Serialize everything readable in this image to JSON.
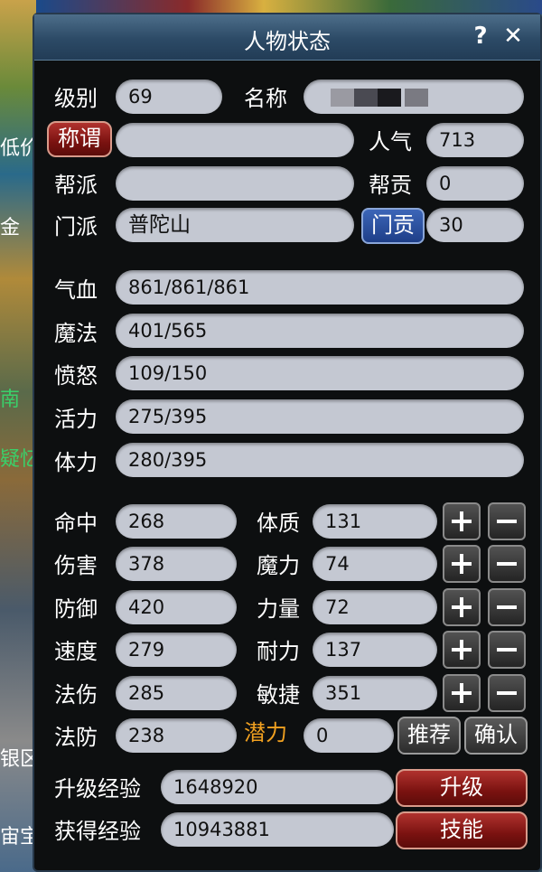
{
  "background": {
    "edge_texts": [
      "低价",
      "金",
      "南",
      "疑忆",
      "银区",
      "宙宝"
    ]
  },
  "window": {
    "title": "人物状态",
    "help": "?",
    "close": "✕"
  },
  "basic": {
    "level_label": "级别",
    "level": "69",
    "name_label": "名称",
    "name": "",
    "title_button": "称谓",
    "title_value": "",
    "popularity_label": "人气",
    "popularity": "713",
    "gang_label": "帮派",
    "gang": "",
    "gang_contrib_label": "帮贡",
    "gang_contrib": "0",
    "sect_label": "门派",
    "sect": "普陀山",
    "sect_contrib_button": "门贡",
    "sect_contrib": "30"
  },
  "vitals": [
    {
      "label": "气血",
      "value": "861/861/861"
    },
    {
      "label": "魔法",
      "value": "401/565"
    },
    {
      "label": "愤怒",
      "value": "109/150"
    },
    {
      "label": "活力",
      "value": "275/395"
    },
    {
      "label": "体力",
      "value": "280/395"
    }
  ],
  "combat": [
    {
      "label": "命中",
      "value": "268"
    },
    {
      "label": "伤害",
      "value": "378"
    },
    {
      "label": "防御",
      "value": "420"
    },
    {
      "label": "速度",
      "value": "279"
    },
    {
      "label": "法伤",
      "value": "285"
    },
    {
      "label": "法防",
      "value": "238"
    }
  ],
  "attributes": [
    {
      "label": "体质",
      "value": "131"
    },
    {
      "label": "魔力",
      "value": "74"
    },
    {
      "label": "力量",
      "value": "72"
    },
    {
      "label": "耐力",
      "value": "137"
    },
    {
      "label": "敏捷",
      "value": "351"
    }
  ],
  "potential": {
    "label": "潜力",
    "value": "0",
    "recommend_button": "推荐",
    "confirm_button": "确认"
  },
  "experience": {
    "upgrade_label": "升级经验",
    "upgrade_value": "1648920",
    "upgrade_button": "升级",
    "gained_label": "获得经验",
    "gained_value": "10943881",
    "skill_button": "技能"
  },
  "colors": {
    "panel_bg": "#0d0f10",
    "field_bg": "#c4c8d2",
    "potential_label": "#f0a020",
    "red_button": "#7a1210",
    "blue_button": "#1e3e88"
  }
}
